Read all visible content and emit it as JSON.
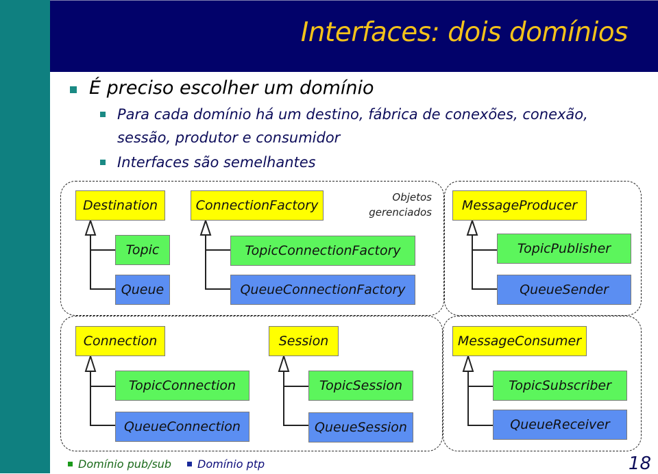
{
  "slide": {
    "title": "Interfaces: dois domínios",
    "page_number": "18",
    "bullets": [
      {
        "level": 1,
        "text": "É preciso escolher um domínio"
      },
      {
        "level": 2,
        "text": "Para cada domínio há um destino, fábrica de conexões, conexão,"
      },
      {
        "level": 2,
        "text": "sessão, produtor e consumidor",
        "continuation": true
      },
      {
        "level": 2,
        "text": "Interfaces são semelhantes"
      }
    ],
    "colors": {
      "sidebar": "#0f8080",
      "header": "#02026a",
      "title": "#f3c21a",
      "parent_interface": "#ffff00",
      "pubsub_interface": "#5cf55c",
      "ptp_interface": "#5b8ef2"
    }
  },
  "diagram": {
    "managed_objects_note": [
      "Objetos",
      "gerenciados"
    ],
    "hierarchies": [
      {
        "parent": "Destination",
        "topic": "Topic",
        "queue": "Queue"
      },
      {
        "parent": "ConnectionFactory",
        "topic": "TopicConnectionFactory",
        "queue": "QueueConnectionFactory"
      },
      {
        "parent": "MessageProducer",
        "topic": "TopicPublisher",
        "queue": "QueueSender"
      },
      {
        "parent": "Connection",
        "topic": "TopicConnection",
        "queue": "QueueConnection"
      },
      {
        "parent": "Session",
        "topic": "TopicSession",
        "queue": "QueueSession"
      },
      {
        "parent": "MessageConsumer",
        "topic": "TopicSubscriber",
        "queue": "QueueReceiver"
      }
    ]
  },
  "legend": [
    {
      "label": "Domínio pub/sub",
      "color": "#1a9a1a"
    },
    {
      "label": "Domínio ptp",
      "color": "#1a2a9a"
    }
  ]
}
